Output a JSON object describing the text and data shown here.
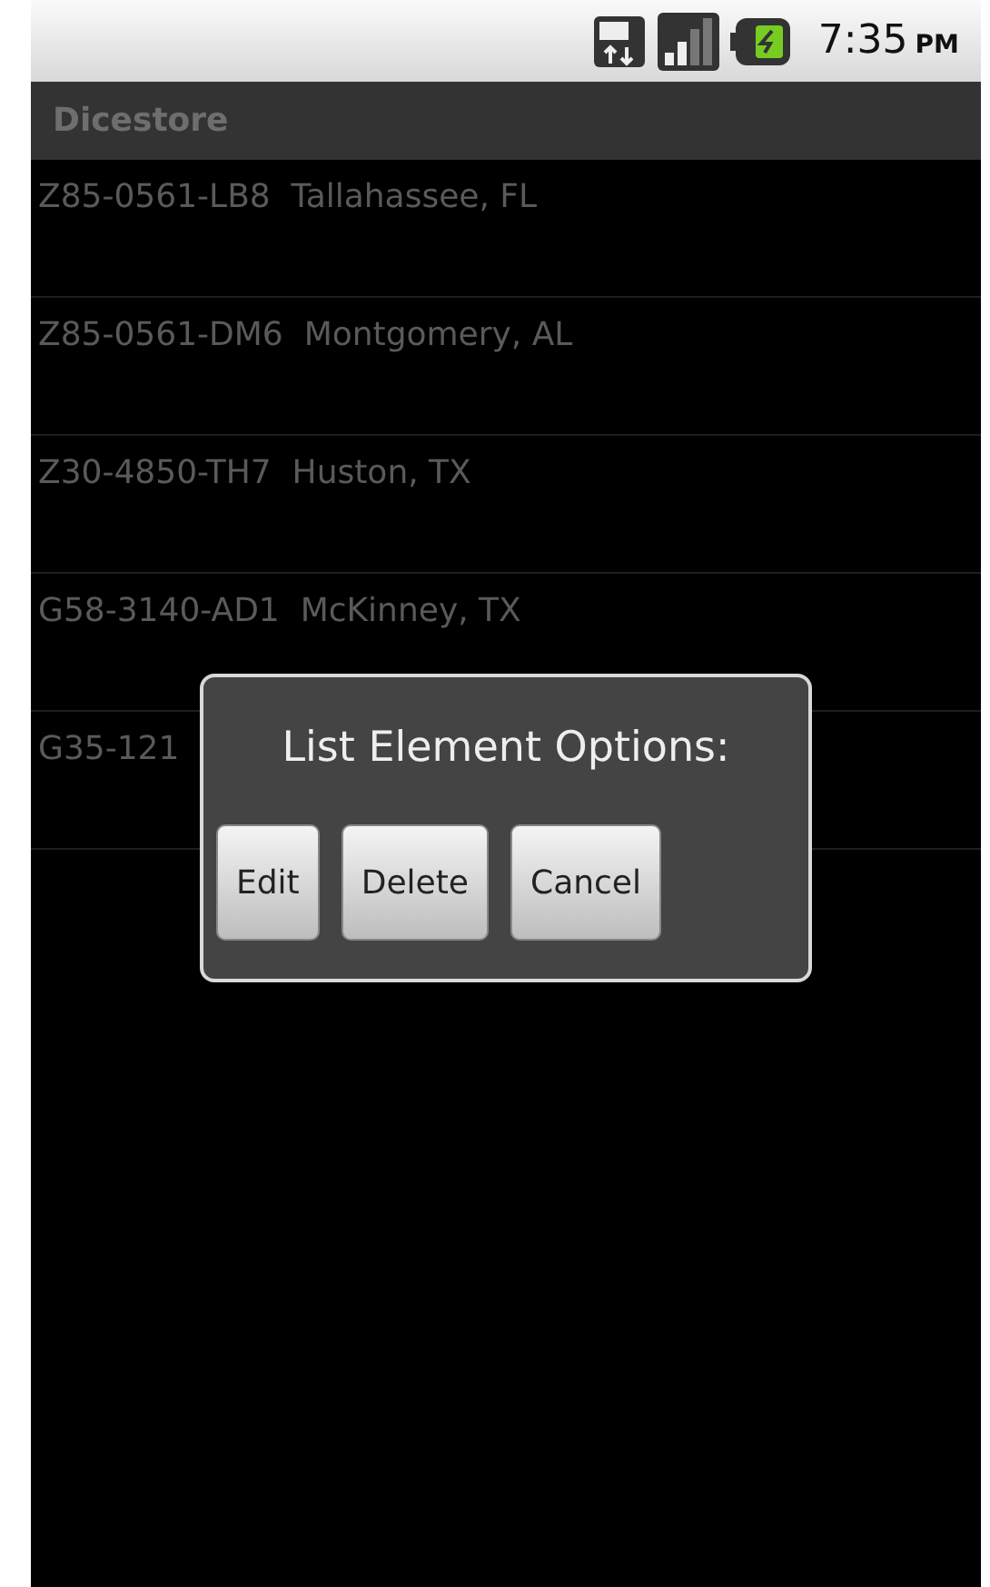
{
  "status_bar": {
    "time": "7:35",
    "ampm": "PM"
  },
  "title_bar": {
    "title": "Dicestore"
  },
  "list": {
    "items": [
      {
        "text": "Z85-0561-LB8  Tallahassee, FL"
      },
      {
        "text": "Z85-0561-DM6  Montgomery, AL"
      },
      {
        "text": "Z30-4850-TH7  Huston, TX"
      },
      {
        "text": "G58-3140-AD1  McKinney, TX"
      },
      {
        "text": "G35-121"
      }
    ]
  },
  "dialog": {
    "title": "List Element Options:",
    "buttons": [
      "Edit",
      "Delete",
      "Cancel"
    ]
  }
}
